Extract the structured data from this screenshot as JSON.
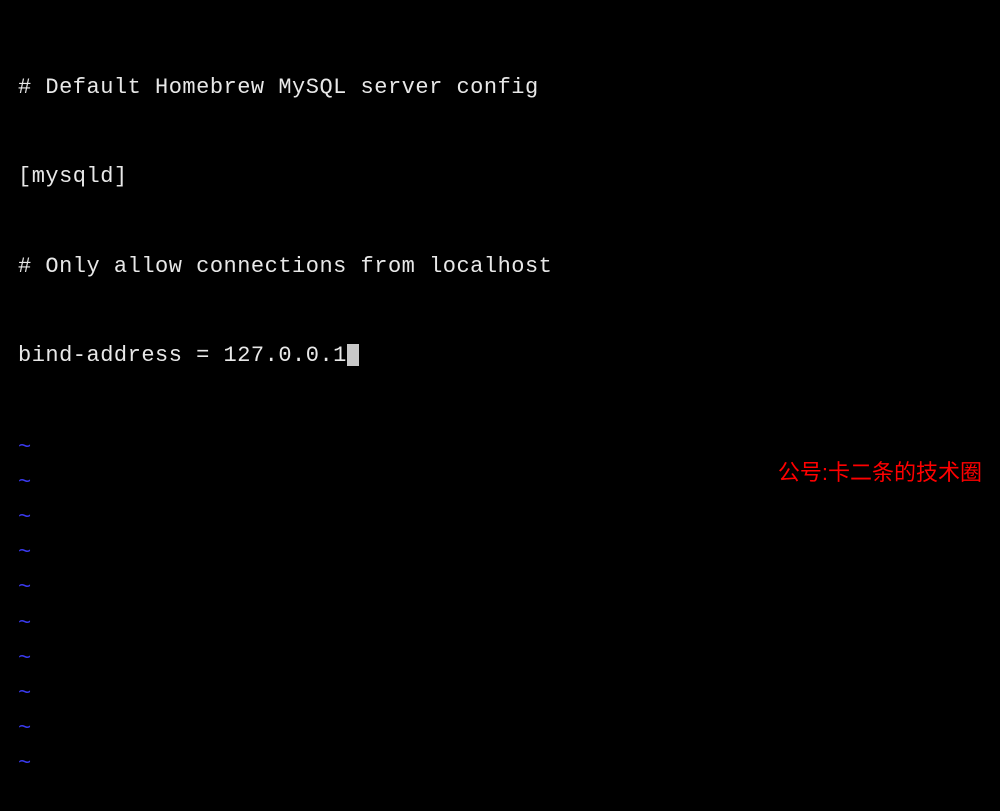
{
  "editor": {
    "lines": {
      "line1": "# Default Homebrew MySQL server config",
      "line2": "[mysqld]",
      "line3": "# Only allow connections from localhost",
      "line4": "bind-address = 127.0.0.1"
    },
    "tilde": "~",
    "tilde_count": 10
  },
  "watermark": {
    "text": "公号:卡二条的技术圈"
  }
}
